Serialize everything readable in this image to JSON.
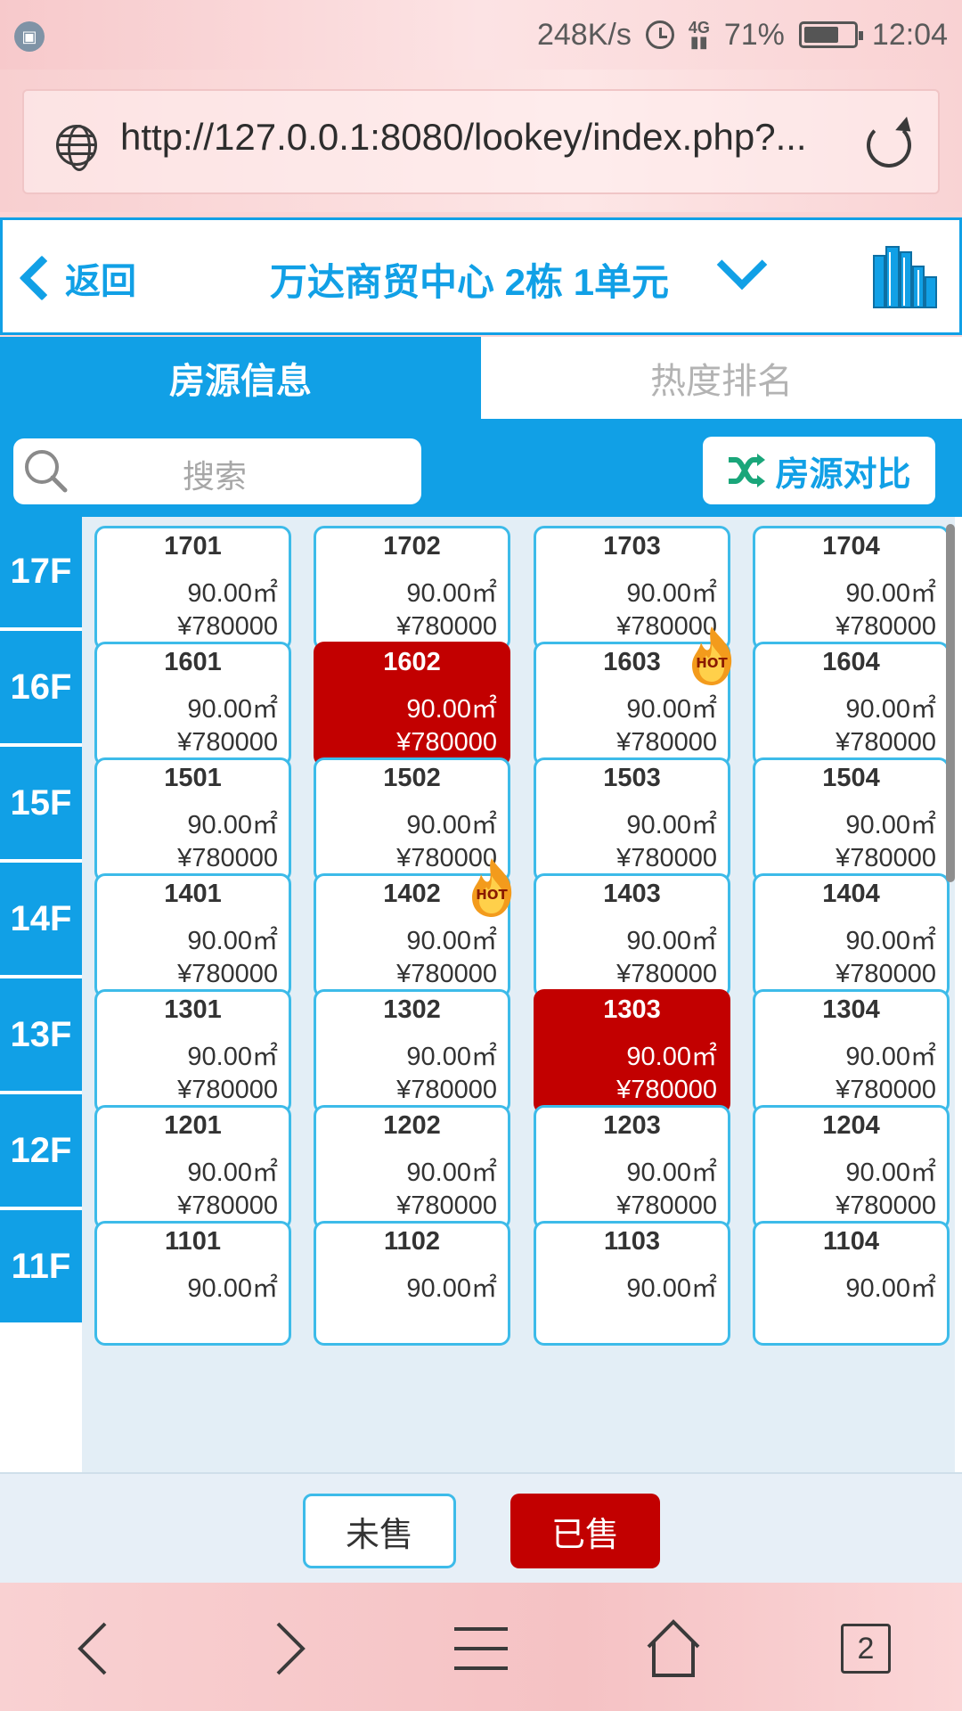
{
  "status_bar": {
    "speed": "248K/s",
    "network": "4G",
    "battery": "71%",
    "battery_level": 0.71,
    "time": "12:04"
  },
  "browser": {
    "url": "http://127.0.0.1:8080/lookey/index.php?..."
  },
  "header": {
    "back_label": "返回",
    "title": "万达商贸中心 2栋 1单元"
  },
  "tabs": [
    {
      "label": "房源信息",
      "active": true
    },
    {
      "label": "热度排名",
      "active": false
    }
  ],
  "search": {
    "placeholder": "搜索",
    "compare_label": "房源对比"
  },
  "floors": [
    {
      "label": "17F",
      "units": [
        {
          "no": "1701",
          "area": "90.00㎡",
          "price": "¥780000",
          "sold": false,
          "hot": false
        },
        {
          "no": "1702",
          "area": "90.00㎡",
          "price": "¥780000",
          "sold": false,
          "hot": false
        },
        {
          "no": "1703",
          "area": "90.00㎡",
          "price": "¥780000",
          "sold": false,
          "hot": false
        },
        {
          "no": "1704",
          "area": "90.00㎡",
          "price": "¥780000",
          "sold": false,
          "hot": false
        }
      ]
    },
    {
      "label": "16F",
      "units": [
        {
          "no": "1601",
          "area": "90.00㎡",
          "price": "¥780000",
          "sold": false,
          "hot": false
        },
        {
          "no": "1602",
          "area": "90.00㎡",
          "price": "¥780000",
          "sold": true,
          "hot": false
        },
        {
          "no": "1603",
          "area": "90.00㎡",
          "price": "¥780000",
          "sold": false,
          "hot": true
        },
        {
          "no": "1604",
          "area": "90.00㎡",
          "price": "¥780000",
          "sold": false,
          "hot": false
        }
      ]
    },
    {
      "label": "15F",
      "units": [
        {
          "no": "1501",
          "area": "90.00㎡",
          "price": "¥780000",
          "sold": false,
          "hot": false
        },
        {
          "no": "1502",
          "area": "90.00㎡",
          "price": "¥780000",
          "sold": false,
          "hot": false
        },
        {
          "no": "1503",
          "area": "90.00㎡",
          "price": "¥780000",
          "sold": false,
          "hot": false
        },
        {
          "no": "1504",
          "area": "90.00㎡",
          "price": "¥780000",
          "sold": false,
          "hot": false
        }
      ]
    },
    {
      "label": "14F",
      "units": [
        {
          "no": "1401",
          "area": "90.00㎡",
          "price": "¥780000",
          "sold": false,
          "hot": false
        },
        {
          "no": "1402",
          "area": "90.00㎡",
          "price": "¥780000",
          "sold": false,
          "hot": true
        },
        {
          "no": "1403",
          "area": "90.00㎡",
          "price": "¥780000",
          "sold": false,
          "hot": false
        },
        {
          "no": "1404",
          "area": "90.00㎡",
          "price": "¥780000",
          "sold": false,
          "hot": false
        }
      ]
    },
    {
      "label": "13F",
      "units": [
        {
          "no": "1301",
          "area": "90.00㎡",
          "price": "¥780000",
          "sold": false,
          "hot": false
        },
        {
          "no": "1302",
          "area": "90.00㎡",
          "price": "¥780000",
          "sold": false,
          "hot": false
        },
        {
          "no": "1303",
          "area": "90.00㎡",
          "price": "¥780000",
          "sold": true,
          "hot": false
        },
        {
          "no": "1304",
          "area": "90.00㎡",
          "price": "¥780000",
          "sold": false,
          "hot": false
        }
      ]
    },
    {
      "label": "12F",
      "units": [
        {
          "no": "1201",
          "area": "90.00㎡",
          "price": "¥780000",
          "sold": false,
          "hot": false
        },
        {
          "no": "1202",
          "area": "90.00㎡",
          "price": "¥780000",
          "sold": false,
          "hot": false
        },
        {
          "no": "1203",
          "area": "90.00㎡",
          "price": "¥780000",
          "sold": false,
          "hot": false
        },
        {
          "no": "1204",
          "area": "90.00㎡",
          "price": "¥780000",
          "sold": false,
          "hot": false
        }
      ]
    },
    {
      "label": "11F",
      "units": [
        {
          "no": "1101",
          "area": "90.00㎡",
          "price": "",
          "sold": false,
          "hot": false
        },
        {
          "no": "1102",
          "area": "90.00㎡",
          "price": "",
          "sold": false,
          "hot": false
        },
        {
          "no": "1103",
          "area": "90.00㎡",
          "price": "",
          "sold": false,
          "hot": false
        },
        {
          "no": "1104",
          "area": "90.00㎡",
          "price": "",
          "sold": false,
          "hot": false
        }
      ]
    }
  ],
  "hot_badge": "HOT",
  "legend": {
    "unsold_label": "未售",
    "sold_label": "已售"
  },
  "nav": {
    "tab_count": "2"
  },
  "colors": {
    "accent": "#11a0e6",
    "sold": "#c20000",
    "cell_border": "#3dbbe9"
  }
}
